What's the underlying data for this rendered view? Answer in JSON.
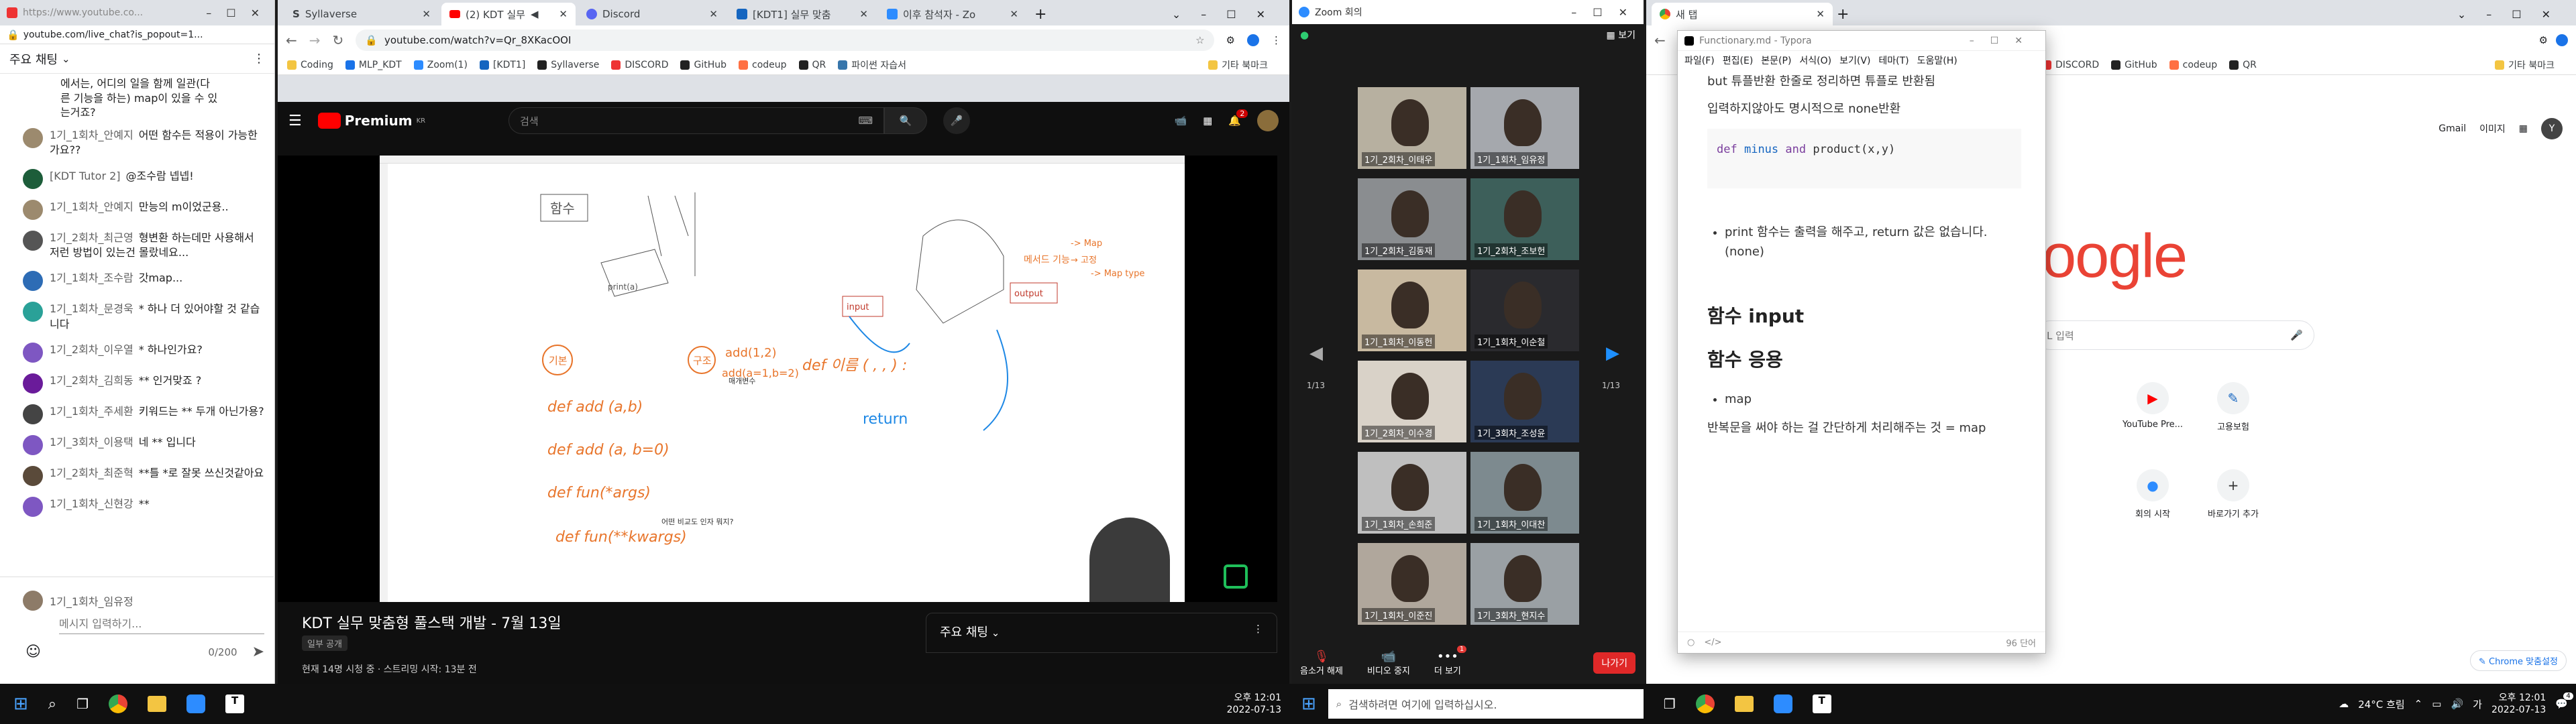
{
  "chat_window": {
    "url": "https://www.youtube.co...",
    "address": "youtube.com/live_chat?is_popout=1...",
    "header": "주요 채팅",
    "top_snippet": [
      "에서는, 어디의 일을 함께 일관(다",
      "른 기능을 하는) map이 있을 수 있",
      "는거죠?"
    ],
    "messages": [
      {
        "author": "1기_1회차_안예지",
        "text": "어떤 함수든 적용이 가능한가요??",
        "color": "#9c8a6e"
      },
      {
        "author": "[KDT Tutor 2]",
        "text": "@조수람 넵넵!",
        "color": "#1d5d3a"
      },
      {
        "author": "1기_1회차_안예지",
        "text": "만능의 m이었군용..",
        "color": "#9c8a6e"
      },
      {
        "author": "1기_2회차_최근영",
        "text": "형변환 하는데만 사용해서 저런 방법이 있는건 몰랐네요...",
        "color": "#555"
      },
      {
        "author": "1기_1회차_조수람",
        "text": "갓map...",
        "color": "#2d6cb5"
      },
      {
        "author": "1기_1회차_문경욱",
        "text": "* 하나 더 있어야할 것 같습니다",
        "color": "#2aa198"
      },
      {
        "author": "1기_2회차_이우열",
        "text": "* 하나인가요?",
        "color": "#7e57c2"
      },
      {
        "author": "1기_2회차_김희동",
        "text": "** 인거맞죠 ?",
        "color": "#6a1b9a"
      },
      {
        "author": "1기_1회차_주세환",
        "text": "키워드는 ** 두개 아닌가용?",
        "color": "#444"
      },
      {
        "author": "1기_3회차_이용택",
        "text": "네 ** 입니다",
        "color": "#7e57c2"
      },
      {
        "author": "1기_2회차_최준혁",
        "text": "**틀 *로 잘못 쓰신것같아요",
        "color": "#5a4a3a"
      },
      {
        "author": "1기_1회차_신현강",
        "text": "**",
        "color": "#7e57c2"
      }
    ],
    "input_user": "1기_1회차_임유정",
    "input_placeholder": "메시지 입력하기...",
    "counter": "0/200"
  },
  "chrome_main": {
    "tabs": [
      "Syllaverse",
      "(2) KDT 실무",
      "Discord",
      "[KDT1] 실무 맞춤",
      "이후 참석자 - Zo"
    ],
    "address": "youtube.com/watch?v=Qr_8XKacOOI",
    "bookmarks": [
      "Coding",
      "MLP_KDT",
      "Zoom(1)",
      "[KDT1]",
      "Syllaverse",
      "DISCORD",
      "GitHub",
      "codeup",
      "QR",
      "파이썬 자습서",
      "기타 북마크"
    ],
    "yt_logo": "Premium",
    "yt_kr": "KR",
    "search_placeholder": "검색",
    "notif_count": "2",
    "video_title": "KDT 실무 맞춤형 풀스택 개발 - 7월 13일",
    "badge": "일부 공개",
    "meta": "현재 14명 시청 중 · 스트리밍 시작: 13분 전",
    "chat_panel_title": "주요 채팅",
    "board": {
      "title_box": "함수",
      "lines": [
        "def add (a,b)",
        "def add (a, b=0)",
        "def fun(*args)",
        "def fun(**kwargs)"
      ],
      "circles": [
        "기본",
        "구조"
      ],
      "call1": "add(1,2)",
      "call2": "add(a=1,b=2)",
      "mid": "def 이름 (  ,  ,  ) :",
      "ret": "return",
      "print_lbl": "print(a)",
      "ann1": "매개변수",
      "ann2": "어떤 비교도 인자 뭐지?",
      "output": "output",
      "input": "input",
      "orange1": "메서드 기능",
      "orange2": "-> Map",
      "orange3": "→ 고정",
      "orange4": "-> Map type"
    }
  },
  "zoom": {
    "title": "Zoom 회의",
    "view_label": "보기",
    "page_left": "1/13",
    "page_right": "1/13",
    "tiles": [
      "1기_2회차_이태우",
      "1기_1회차_임유정",
      "1기_2회차_김동재",
      "1기_2회차_조보헌",
      "1기_1회차_이동헌",
      "1기_1회차_이순철",
      "1기_2회차_이수경",
      "1기_3회차_조성윤",
      "1기_1회차_손희준",
      "1기_1회차_이대찬",
      "1기_1회차_이준진",
      "1기_3회차_현지수"
    ],
    "controls": [
      "음소거 해제",
      "비디오 중지",
      "더 보기"
    ],
    "more_badge": "1",
    "leave": "나가기"
  },
  "chrome_right": {
    "tab": "새 탭",
    "bookmarks": [
      "DISCORD",
      "GitHub",
      "codeup",
      "QR",
      "기타 북마크"
    ],
    "top_links": [
      "Gmail",
      "이미지"
    ],
    "avatar": "Y",
    "search_placeholder": "L 입력",
    "logo": "oogle",
    "shortcuts": [
      "YouTube Pre...",
      "고용보험",
      "회의 시작",
      "바로가기 추가"
    ],
    "customize": "Chrome 맞춤설정"
  },
  "typora": {
    "title": "Functionary.md - Typora",
    "menus": [
      "파일(F)",
      "편집(E)",
      "본문(P)",
      "서식(O)",
      "보기(V)",
      "테마(T)",
      "도움말(H)"
    ],
    "p1": "but 튜플반환 한줄로 정리하면 튜플로 반환됨",
    "p2": "입력하지않아도 명시적으로 none반환",
    "code_kw": "def",
    "code_fn": "minus",
    "code_and": "and",
    "code_rest": "product(x,y)",
    "bullet1": "print 함수는 출력을 해주고, return 값은 없습니다. (none)",
    "h1": "함수 input",
    "h2": "함수 응용",
    "bullet2": "map",
    "p3": "반복문을 써야 하는 걸 간단하게 처리해주는 것 = map",
    "words": "96 단어"
  },
  "taskbar_left": {
    "time": "오후 12:01",
    "date": "2022-07-13"
  },
  "taskbar_right": {
    "search": "검색하려면 여기에 입력하십시오.",
    "weather": "24°C 흐림",
    "lang": "가",
    "time": "오후 12:01",
    "date": "2022-07-13",
    "notif": "4"
  }
}
